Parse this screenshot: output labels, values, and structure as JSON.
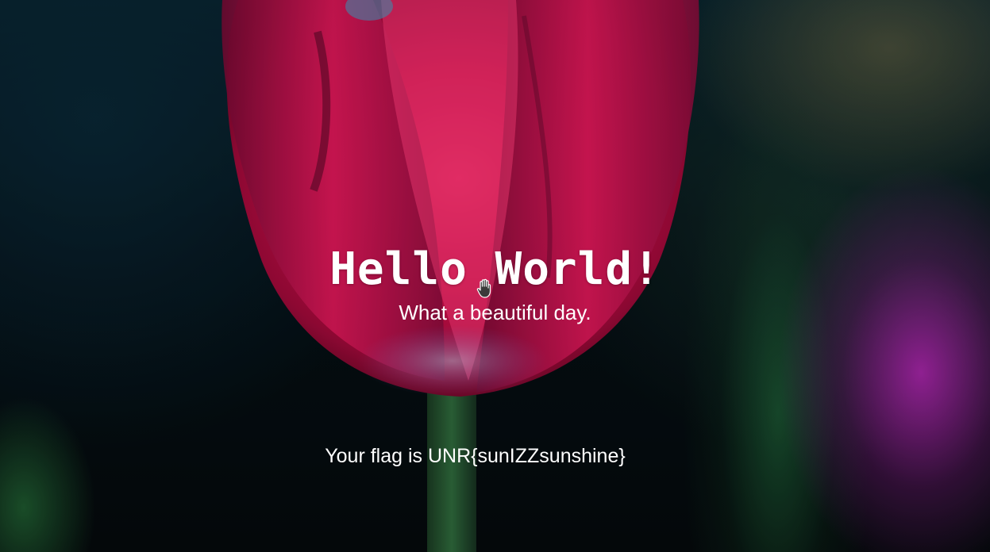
{
  "hero": {
    "title": "Hello World!",
    "subtitle": "What a beautiful day."
  },
  "flag": {
    "text": "Your flag is UNR{sunIZZsunshine}"
  },
  "background": {
    "image": "tulip-photo",
    "colors": {
      "petal": "#d41050",
      "petal_highlight": "#ff3070",
      "stem": "#2a5a35",
      "backdrop": "#040a10"
    }
  },
  "cursor": {
    "icon": "grab-hand-icon"
  }
}
